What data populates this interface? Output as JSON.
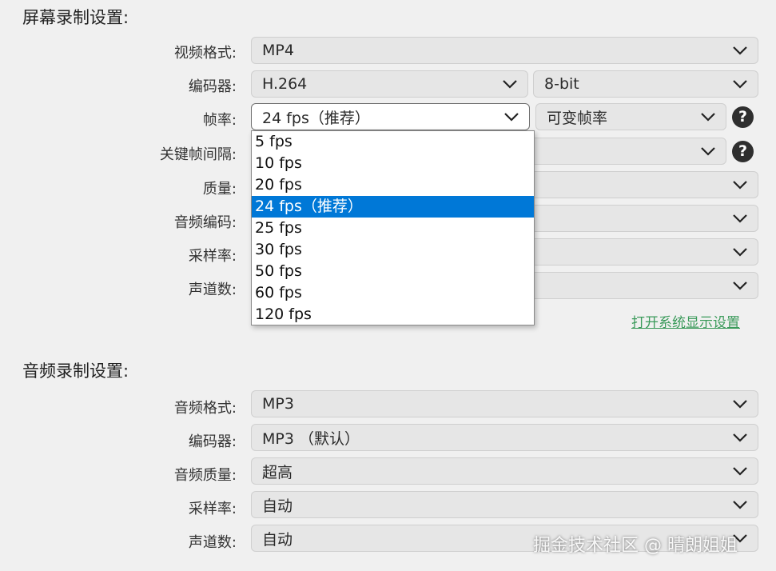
{
  "screen": {
    "title": "屏幕录制设置:",
    "rows": [
      {
        "label": "视频格式:",
        "value": "MP4"
      },
      {
        "label": "编码器:",
        "value": "H.264",
        "secondary": "8-bit"
      },
      {
        "label": "帧率:",
        "value": "24 fps（推荐）",
        "secondary": "可变帧率"
      },
      {
        "label": "关键帧间隔:"
      },
      {
        "label": "质量:"
      },
      {
        "label": "音频编码:"
      },
      {
        "label": "采样率:"
      },
      {
        "label": "声道数:"
      }
    ],
    "link": "打开系统显示设置"
  },
  "fps_dropdown": {
    "options": [
      "5 fps",
      "10 fps",
      "20 fps",
      "24 fps（推荐）",
      "25 fps",
      "30 fps",
      "50 fps",
      "60 fps",
      "120 fps"
    ],
    "selected_index": 3
  },
  "audio": {
    "title": "音频录制设置:",
    "rows": [
      {
        "label": "音频格式:",
        "value": "MP3"
      },
      {
        "label": "编码器:",
        "value": "MP3 （默认）"
      },
      {
        "label": "音频质量:",
        "value": "超高"
      },
      {
        "label": "采样率:",
        "value": "自动"
      },
      {
        "label": "声道数:",
        "value": "自动"
      }
    ]
  },
  "icons": {
    "help": "?"
  },
  "watermark": "掘金技术社区 @ 晴朗姐姐",
  "colors": {
    "accent": "#0078d7",
    "link": "#3a9a5a",
    "field_bg": "#e6e6e6",
    "page_bg": "#f0f0f0"
  }
}
